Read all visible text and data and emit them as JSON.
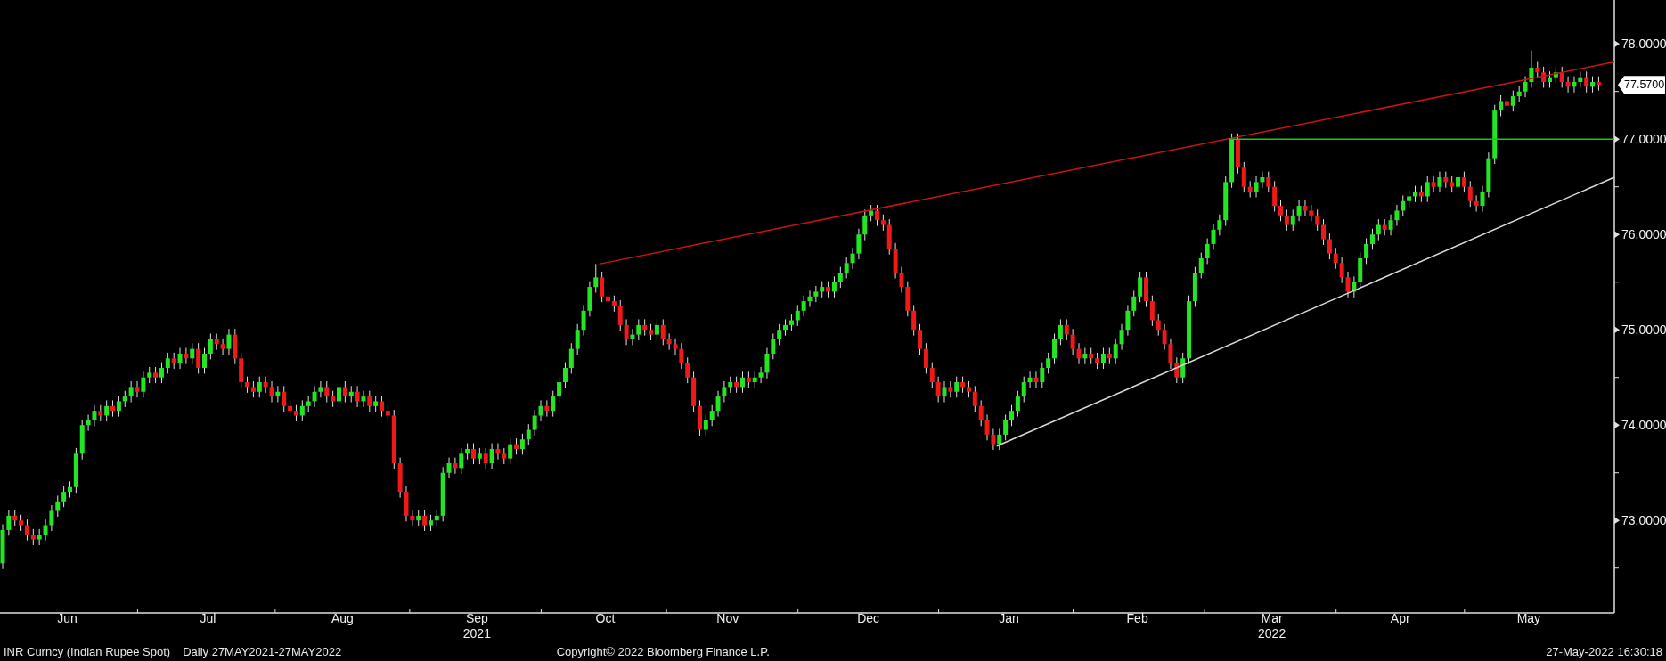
{
  "chart": {
    "chart_data": {
      "type": "candlestick",
      "ylim": [
        72.03,
        78.46
      ],
      "yticks": [
        {
          "value": 73,
          "label": "73.0000"
        },
        {
          "value": 74,
          "label": "74.0000"
        },
        {
          "value": 75,
          "label": "75.0000"
        },
        {
          "value": 76,
          "label": "76.0000"
        },
        {
          "value": 77,
          "label": "77.0000"
        },
        {
          "value": 78,
          "label": "78.0000"
        }
      ],
      "categories": [
        null,
        null,
        null,
        null,
        null,
        null,
        null,
        null,
        null,
        null,
        null,
        "Jun",
        null,
        null,
        null,
        null,
        null,
        null,
        null,
        null,
        null,
        null,
        null,
        null,
        null,
        null,
        null,
        null,
        null,
        null,
        null,
        null,
        null,
        null,
        "Jul",
        null,
        null,
        null,
        null,
        null,
        null,
        null,
        null,
        null,
        null,
        null,
        null,
        null,
        null,
        null,
        null,
        null,
        null,
        null,
        null,
        null,
        "Aug",
        null,
        null,
        null,
        null,
        null,
        null,
        null,
        null,
        null,
        null,
        null,
        null,
        null,
        null,
        null,
        null,
        null,
        null,
        null,
        null,
        null,
        "Sep",
        null,
        null,
        null,
        null,
        null,
        null,
        null,
        null,
        null,
        null,
        null,
        null,
        null,
        null,
        null,
        null,
        null,
        null,
        null,
        null,
        "Oct",
        null,
        null,
        null,
        null,
        null,
        null,
        null,
        null,
        null,
        null,
        null,
        null,
        null,
        null,
        null,
        null,
        null,
        null,
        null,
        "Nov",
        null,
        null,
        null,
        null,
        null,
        null,
        null,
        null,
        null,
        null,
        null,
        null,
        null,
        null,
        null,
        null,
        null,
        null,
        null,
        null,
        null,
        null,
        "Dec",
        null,
        null,
        null,
        null,
        null,
        null,
        null,
        null,
        null,
        null,
        null,
        null,
        null,
        null,
        null,
        null,
        null,
        null,
        null,
        null,
        null,
        null,
        "Jan",
        null,
        null,
        null,
        null,
        null,
        null,
        null,
        null,
        null,
        null,
        null,
        null,
        null,
        null,
        null,
        null,
        null,
        null,
        null,
        null,
        "Feb",
        null,
        null,
        null,
        null,
        null,
        null,
        null,
        null,
        null,
        null,
        null,
        null,
        null,
        null,
        null,
        null,
        null,
        null,
        null,
        null,
        null,
        "Mar",
        null,
        null,
        null,
        null,
        null,
        null,
        null,
        null,
        null,
        null,
        null,
        null,
        null,
        null,
        null,
        null,
        null,
        null,
        null,
        null,
        "Apr",
        null,
        null,
        null,
        null,
        null,
        null,
        null,
        null,
        null,
        null,
        null,
        null,
        null,
        null,
        null,
        null,
        null,
        null,
        null,
        null,
        "May",
        null,
        null,
        null,
        null,
        null,
        null,
        null,
        null,
        null,
        null,
        null
      ],
      "ohlc": [
        [
          72.55,
          72.96,
          72.49,
          72.9
        ],
        [
          72.9,
          73.11,
          72.84,
          73.05
        ],
        [
          73.05,
          73.11,
          72.94,
          73.0
        ],
        [
          73.0,
          73.06,
          72.89,
          72.95
        ],
        [
          72.95,
          73.01,
          72.79,
          72.85
        ],
        [
          72.85,
          72.91,
          72.74,
          72.8
        ],
        [
          72.8,
          72.91,
          72.74,
          72.85
        ],
        [
          72.85,
          73.01,
          72.79,
          72.95
        ],
        [
          72.95,
          73.16,
          72.89,
          73.1
        ],
        [
          73.1,
          73.26,
          73.04,
          73.2
        ],
        [
          73.2,
          73.36,
          73.14,
          73.3
        ],
        [
          73.3,
          73.41,
          73.24,
          73.35
        ],
        [
          73.35,
          73.76,
          73.29,
          73.7
        ],
        [
          73.7,
          74.06,
          73.64,
          74.0
        ],
        [
          74.0,
          74.11,
          73.94,
          74.05
        ],
        [
          74.05,
          74.21,
          73.99,
          74.15
        ],
        [
          74.15,
          74.21,
          74.04,
          74.1
        ],
        [
          74.1,
          74.26,
          74.04,
          74.2
        ],
        [
          74.2,
          74.26,
          74.09,
          74.15
        ],
        [
          74.15,
          74.31,
          74.09,
          74.25
        ],
        [
          74.25,
          74.36,
          74.19,
          74.3
        ],
        [
          74.3,
          74.46,
          74.24,
          74.4
        ],
        [
          74.4,
          74.46,
          74.29,
          74.35
        ],
        [
          74.35,
          74.56,
          74.29,
          74.5
        ],
        [
          74.5,
          74.61,
          74.44,
          74.55
        ],
        [
          74.55,
          74.61,
          74.44,
          74.5
        ],
        [
          74.5,
          74.66,
          74.44,
          74.6
        ],
        [
          74.6,
          74.76,
          74.54,
          74.7
        ],
        [
          74.7,
          74.76,
          74.59,
          74.65
        ],
        [
          74.65,
          74.81,
          74.59,
          74.75
        ],
        [
          74.75,
          74.81,
          74.64,
          74.7
        ],
        [
          74.7,
          74.86,
          74.64,
          74.8
        ],
        [
          74.8,
          74.86,
          74.54,
          74.6
        ],
        [
          74.6,
          74.81,
          74.54,
          74.75
        ],
        [
          74.75,
          74.96,
          74.69,
          74.9
        ],
        [
          74.9,
          74.96,
          74.79,
          74.85
        ],
        [
          74.85,
          74.91,
          74.74,
          74.8
        ],
        [
          74.8,
          75.01,
          74.74,
          74.95
        ],
        [
          74.95,
          75.01,
          74.64,
          74.7
        ],
        [
          74.7,
          74.76,
          74.39,
          74.45
        ],
        [
          74.45,
          74.51,
          74.34,
          74.4
        ],
        [
          74.4,
          74.46,
          74.29,
          74.35
        ],
        [
          74.35,
          74.51,
          74.29,
          74.45
        ],
        [
          74.45,
          74.51,
          74.34,
          74.4
        ],
        [
          74.4,
          74.46,
          74.24,
          74.3
        ],
        [
          74.3,
          74.41,
          74.24,
          74.35
        ],
        [
          74.35,
          74.41,
          74.14,
          74.2
        ],
        [
          74.2,
          74.26,
          74.09,
          74.15
        ],
        [
          74.15,
          74.21,
          74.04,
          74.1
        ],
        [
          74.1,
          74.26,
          74.04,
          74.2
        ],
        [
          74.2,
          74.31,
          74.14,
          74.25
        ],
        [
          74.25,
          74.41,
          74.19,
          74.35
        ],
        [
          74.35,
          74.46,
          74.29,
          74.4
        ],
        [
          74.4,
          74.46,
          74.24,
          74.3
        ],
        [
          74.3,
          74.36,
          74.19,
          74.25
        ],
        [
          74.25,
          74.46,
          74.19,
          74.4
        ],
        [
          74.4,
          74.46,
          74.24,
          74.3
        ],
        [
          74.3,
          74.41,
          74.24,
          74.35
        ],
        [
          74.35,
          74.41,
          74.19,
          74.25
        ],
        [
          74.25,
          74.36,
          74.19,
          74.3
        ],
        [
          74.3,
          74.36,
          74.14,
          74.2
        ],
        [
          74.2,
          74.31,
          74.14,
          74.25
        ],
        [
          74.25,
          74.31,
          74.09,
          74.15
        ],
        [
          74.15,
          74.21,
          74.04,
          74.1
        ],
        [
          74.1,
          74.16,
          73.54,
          73.6
        ],
        [
          73.6,
          73.66,
          73.24,
          73.3
        ],
        [
          73.3,
          73.36,
          72.99,
          73.05
        ],
        [
          73.05,
          73.11,
          72.94,
          73.0
        ],
        [
          73.0,
          73.11,
          72.94,
          73.05
        ],
        [
          73.05,
          73.11,
          72.89,
          72.95
        ],
        [
          72.95,
          73.06,
          72.89,
          73.0
        ],
        [
          73.0,
          73.11,
          72.94,
          73.05
        ],
        [
          73.05,
          73.56,
          72.99,
          73.5
        ],
        [
          73.5,
          73.66,
          73.44,
          73.6
        ],
        [
          73.6,
          73.66,
          73.49,
          73.55
        ],
        [
          73.55,
          73.76,
          73.49,
          73.7
        ],
        [
          73.7,
          73.81,
          73.64,
          73.75
        ],
        [
          73.75,
          73.81,
          73.59,
          73.65
        ],
        [
          73.65,
          73.76,
          73.59,
          73.7
        ],
        [
          73.7,
          73.76,
          73.54,
          73.6
        ],
        [
          73.6,
          73.81,
          73.54,
          73.75
        ],
        [
          73.75,
          73.81,
          73.64,
          73.7
        ],
        [
          73.7,
          73.76,
          73.59,
          73.65
        ],
        [
          73.65,
          73.86,
          73.59,
          73.8
        ],
        [
          73.8,
          73.86,
          73.69,
          73.75
        ],
        [
          73.75,
          73.91,
          73.69,
          73.85
        ],
        [
          73.85,
          74.01,
          73.79,
          73.95
        ],
        [
          73.95,
          74.16,
          73.89,
          74.1
        ],
        [
          74.1,
          74.26,
          74.04,
          74.2
        ],
        [
          74.2,
          74.26,
          74.09,
          74.15
        ],
        [
          74.15,
          74.36,
          74.09,
          74.3
        ],
        [
          74.3,
          74.51,
          74.24,
          74.45
        ],
        [
          74.45,
          74.66,
          74.39,
          74.6
        ],
        [
          74.6,
          74.86,
          74.54,
          74.8
        ],
        [
          74.8,
          75.06,
          74.74,
          75.0
        ],
        [
          75.0,
          75.26,
          74.94,
          75.2
        ],
        [
          75.2,
          75.51,
          75.14,
          75.45
        ],
        [
          75.45,
          75.69,
          75.39,
          75.55
        ],
        [
          75.55,
          75.61,
          75.29,
          75.35
        ],
        [
          75.35,
          75.41,
          75.24,
          75.3
        ],
        [
          75.3,
          75.36,
          75.19,
          75.25
        ],
        [
          75.25,
          75.31,
          74.99,
          75.05
        ],
        [
          75.05,
          75.11,
          74.84,
          74.9
        ],
        [
          74.9,
          75.01,
          74.84,
          74.95
        ],
        [
          74.95,
          75.11,
          74.89,
          75.05
        ],
        [
          75.05,
          75.11,
          74.94,
          75.0
        ],
        [
          75.0,
          75.06,
          74.89,
          74.95
        ],
        [
          74.95,
          75.11,
          74.89,
          75.05
        ],
        [
          75.05,
          75.11,
          74.84,
          74.9
        ],
        [
          74.9,
          74.96,
          74.79,
          74.85
        ],
        [
          74.85,
          74.91,
          74.74,
          74.8
        ],
        [
          74.8,
          74.86,
          74.59,
          74.65
        ],
        [
          74.65,
          74.71,
          74.44,
          74.5
        ],
        [
          74.5,
          74.56,
          74.14,
          74.2
        ],
        [
          74.2,
          74.26,
          73.89,
          73.95
        ],
        [
          73.95,
          74.11,
          73.89,
          74.05
        ],
        [
          74.05,
          74.21,
          73.99,
          74.15
        ],
        [
          74.15,
          74.36,
          74.09,
          74.3
        ],
        [
          74.3,
          74.46,
          74.24,
          74.4
        ],
        [
          74.4,
          74.51,
          74.34,
          74.45
        ],
        [
          74.45,
          74.51,
          74.34,
          74.4
        ],
        [
          74.4,
          74.56,
          74.34,
          74.5
        ],
        [
          74.5,
          74.56,
          74.39,
          74.45
        ],
        [
          74.45,
          74.56,
          74.39,
          74.5
        ],
        [
          74.5,
          74.61,
          74.44,
          74.55
        ],
        [
          74.55,
          74.81,
          74.49,
          74.75
        ],
        [
          74.75,
          74.96,
          74.69,
          74.9
        ],
        [
          74.9,
          75.06,
          74.84,
          75.0
        ],
        [
          75.0,
          75.11,
          74.94,
          75.05
        ],
        [
          75.05,
          75.16,
          74.99,
          75.1
        ],
        [
          75.1,
          75.26,
          75.04,
          75.2
        ],
        [
          75.2,
          75.36,
          75.14,
          75.3
        ],
        [
          75.3,
          75.41,
          75.24,
          75.35
        ],
        [
          75.35,
          75.46,
          75.29,
          75.4
        ],
        [
          75.4,
          75.51,
          75.34,
          75.45
        ],
        [
          75.45,
          75.51,
          75.34,
          75.4
        ],
        [
          75.4,
          75.56,
          75.34,
          75.5
        ],
        [
          75.5,
          75.66,
          75.44,
          75.6
        ],
        [
          75.6,
          75.76,
          75.54,
          75.7
        ],
        [
          75.7,
          75.86,
          75.64,
          75.8
        ],
        [
          75.8,
          76.06,
          75.74,
          76.0
        ],
        [
          76.0,
          76.26,
          75.94,
          76.2
        ],
        [
          76.2,
          76.31,
          76.14,
          76.25
        ],
        [
          76.25,
          76.31,
          76.09,
          76.15
        ],
        [
          76.15,
          76.21,
          76.04,
          76.1
        ],
        [
          76.1,
          76.16,
          75.79,
          75.85
        ],
        [
          75.85,
          75.91,
          75.54,
          75.6
        ],
        [
          75.6,
          75.66,
          75.39,
          75.45
        ],
        [
          75.45,
          75.51,
          75.14,
          75.2
        ],
        [
          75.2,
          75.26,
          74.94,
          75.0
        ],
        [
          75.0,
          75.06,
          74.74,
          74.8
        ],
        [
          74.8,
          74.86,
          74.54,
          74.6
        ],
        [
          74.6,
          74.66,
          74.39,
          74.45
        ],
        [
          74.45,
          74.51,
          74.24,
          74.3
        ],
        [
          74.3,
          74.46,
          74.24,
          74.4
        ],
        [
          74.4,
          74.46,
          74.29,
          74.35
        ],
        [
          74.35,
          74.51,
          74.29,
          74.45
        ],
        [
          74.45,
          74.51,
          74.34,
          74.4
        ],
        [
          74.4,
          74.46,
          74.29,
          74.35
        ],
        [
          74.35,
          74.41,
          74.14,
          74.2
        ],
        [
          74.2,
          74.26,
          73.99,
          74.05
        ],
        [
          74.05,
          74.11,
          73.84,
          73.9
        ],
        [
          73.9,
          73.96,
          73.74,
          73.8
        ],
        [
          73.8,
          73.96,
          73.74,
          73.9
        ],
        [
          73.9,
          74.11,
          73.84,
          74.05
        ],
        [
          74.05,
          74.21,
          73.99,
          74.15
        ],
        [
          74.15,
          74.36,
          74.09,
          74.3
        ],
        [
          74.3,
          74.51,
          74.24,
          74.45
        ],
        [
          74.45,
          74.56,
          74.39,
          74.5
        ],
        [
          74.5,
          74.56,
          74.39,
          74.45
        ],
        [
          74.45,
          74.66,
          74.39,
          74.6
        ],
        [
          74.6,
          74.76,
          74.54,
          74.7
        ],
        [
          74.7,
          74.96,
          74.64,
          74.9
        ],
        [
          74.9,
          75.11,
          74.84,
          75.05
        ],
        [
          75.05,
          75.11,
          74.89,
          74.95
        ],
        [
          74.95,
          75.01,
          74.74,
          74.8
        ],
        [
          74.8,
          74.86,
          74.64,
          74.7
        ],
        [
          74.7,
          74.81,
          74.64,
          74.75
        ],
        [
          74.75,
          74.81,
          74.64,
          74.7
        ],
        [
          74.7,
          74.76,
          74.59,
          74.65
        ],
        [
          74.65,
          74.81,
          74.59,
          74.75
        ],
        [
          74.75,
          74.81,
          74.64,
          74.7
        ],
        [
          74.7,
          74.91,
          74.64,
          74.85
        ],
        [
          74.85,
          75.06,
          74.79,
          75.0
        ],
        [
          75.0,
          75.26,
          74.94,
          75.2
        ],
        [
          75.2,
          75.41,
          75.14,
          75.35
        ],
        [
          75.35,
          75.61,
          75.29,
          75.55
        ],
        [
          75.55,
          75.61,
          75.24,
          75.3
        ],
        [
          75.3,
          75.36,
          75.04,
          75.1
        ],
        [
          75.1,
          75.16,
          74.94,
          75.0
        ],
        [
          75.0,
          75.06,
          74.79,
          74.85
        ],
        [
          74.85,
          74.91,
          74.59,
          74.65
        ],
        [
          74.65,
          74.71,
          74.44,
          74.5
        ],
        [
          74.5,
          74.76,
          74.44,
          74.7
        ],
        [
          74.7,
          75.36,
          74.64,
          75.3
        ],
        [
          75.3,
          75.66,
          75.24,
          75.6
        ],
        [
          75.6,
          75.81,
          75.54,
          75.75
        ],
        [
          75.75,
          75.96,
          75.69,
          75.9
        ],
        [
          75.9,
          76.11,
          75.84,
          76.05
        ],
        [
          76.05,
          76.21,
          75.99,
          76.15
        ],
        [
          76.15,
          76.61,
          76.09,
          76.55
        ],
        [
          76.55,
          77.06,
          76.49,
          77.0
        ],
        [
          77.0,
          77.06,
          76.64,
          76.7
        ],
        [
          76.7,
          76.76,
          76.44,
          76.5
        ],
        [
          76.5,
          76.56,
          76.39,
          76.45
        ],
        [
          76.45,
          76.61,
          76.39,
          76.55
        ],
        [
          76.55,
          76.66,
          76.49,
          76.6
        ],
        [
          76.6,
          76.66,
          76.44,
          76.5
        ],
        [
          76.5,
          76.56,
          76.24,
          76.3
        ],
        [
          76.3,
          76.36,
          76.14,
          76.2
        ],
        [
          76.2,
          76.26,
          76.04,
          76.1
        ],
        [
          76.1,
          76.26,
          76.04,
          76.2
        ],
        [
          76.2,
          76.36,
          76.14,
          76.3
        ],
        [
          76.3,
          76.36,
          76.19,
          76.25
        ],
        [
          76.25,
          76.31,
          76.14,
          76.2
        ],
        [
          76.2,
          76.26,
          76.04,
          76.1
        ],
        [
          76.1,
          76.16,
          75.89,
          75.95
        ],
        [
          75.95,
          76.01,
          75.74,
          75.8
        ],
        [
          75.8,
          75.86,
          75.64,
          75.7
        ],
        [
          75.7,
          75.76,
          75.49,
          75.55
        ],
        [
          75.55,
          75.61,
          75.34,
          75.4
        ],
        [
          75.4,
          75.56,
          75.34,
          75.5
        ],
        [
          75.5,
          75.81,
          75.44,
          75.75
        ],
        [
          75.75,
          75.96,
          75.69,
          75.9
        ],
        [
          75.9,
          76.06,
          75.84,
          76.0
        ],
        [
          76.0,
          76.16,
          75.94,
          76.1
        ],
        [
          76.1,
          76.16,
          75.99,
          76.05
        ],
        [
          76.05,
          76.21,
          75.99,
          76.15
        ],
        [
          76.15,
          76.31,
          76.09,
          76.25
        ],
        [
          76.25,
          76.41,
          76.19,
          76.35
        ],
        [
          76.35,
          76.46,
          76.29,
          76.4
        ],
        [
          76.4,
          76.51,
          76.34,
          76.45
        ],
        [
          76.45,
          76.51,
          76.34,
          76.4
        ],
        [
          76.4,
          76.61,
          76.34,
          76.55
        ],
        [
          76.55,
          76.61,
          76.44,
          76.5
        ],
        [
          76.5,
          76.66,
          76.44,
          76.6
        ],
        [
          76.6,
          76.66,
          76.49,
          76.55
        ],
        [
          76.55,
          76.61,
          76.44,
          76.5
        ],
        [
          76.5,
          76.66,
          76.44,
          76.6
        ],
        [
          76.6,
          76.66,
          76.44,
          76.5
        ],
        [
          76.5,
          76.56,
          76.29,
          76.35
        ],
        [
          76.35,
          76.41,
          76.24,
          76.3
        ],
        [
          76.3,
          76.51,
          76.24,
          76.45
        ],
        [
          76.45,
          76.86,
          76.39,
          76.8
        ],
        [
          76.8,
          77.36,
          76.74,
          77.3
        ],
        [
          77.3,
          77.46,
          77.24,
          77.4
        ],
        [
          77.4,
          77.46,
          77.29,
          77.35
        ],
        [
          77.35,
          77.51,
          77.29,
          77.45
        ],
        [
          77.45,
          77.56,
          77.39,
          77.5
        ],
        [
          77.5,
          77.66,
          77.44,
          77.6
        ],
        [
          77.6,
          77.93,
          77.54,
          77.75
        ],
        [
          77.75,
          77.81,
          77.64,
          77.7
        ],
        [
          77.7,
          77.76,
          77.54,
          77.6
        ],
        [
          77.6,
          77.71,
          77.54,
          77.65
        ],
        [
          77.65,
          77.76,
          77.59,
          77.7
        ],
        [
          77.7,
          77.76,
          77.54,
          77.6
        ],
        [
          77.6,
          77.66,
          77.49,
          77.55
        ],
        [
          77.55,
          77.66,
          77.49,
          77.6
        ],
        [
          77.6,
          77.71,
          77.54,
          77.65
        ],
        [
          77.65,
          77.71,
          77.49,
          77.55
        ],
        [
          77.55,
          77.66,
          77.49,
          77.6
        ],
        [
          77.6,
          77.66,
          77.51,
          77.57
        ]
      ]
    },
    "last_price": "77.5700",
    "year_labels": [
      "2021",
      "2022"
    ]
  },
  "footer": {
    "security": "INR Curncy (Indian Rupee Spot)",
    "period": "Daily 27MAY2021-27MAY2022",
    "copyright": "Copyright© 2022 Bloomberg Finance L.P.",
    "timestamp": "27-May-2022 16:30:18"
  }
}
